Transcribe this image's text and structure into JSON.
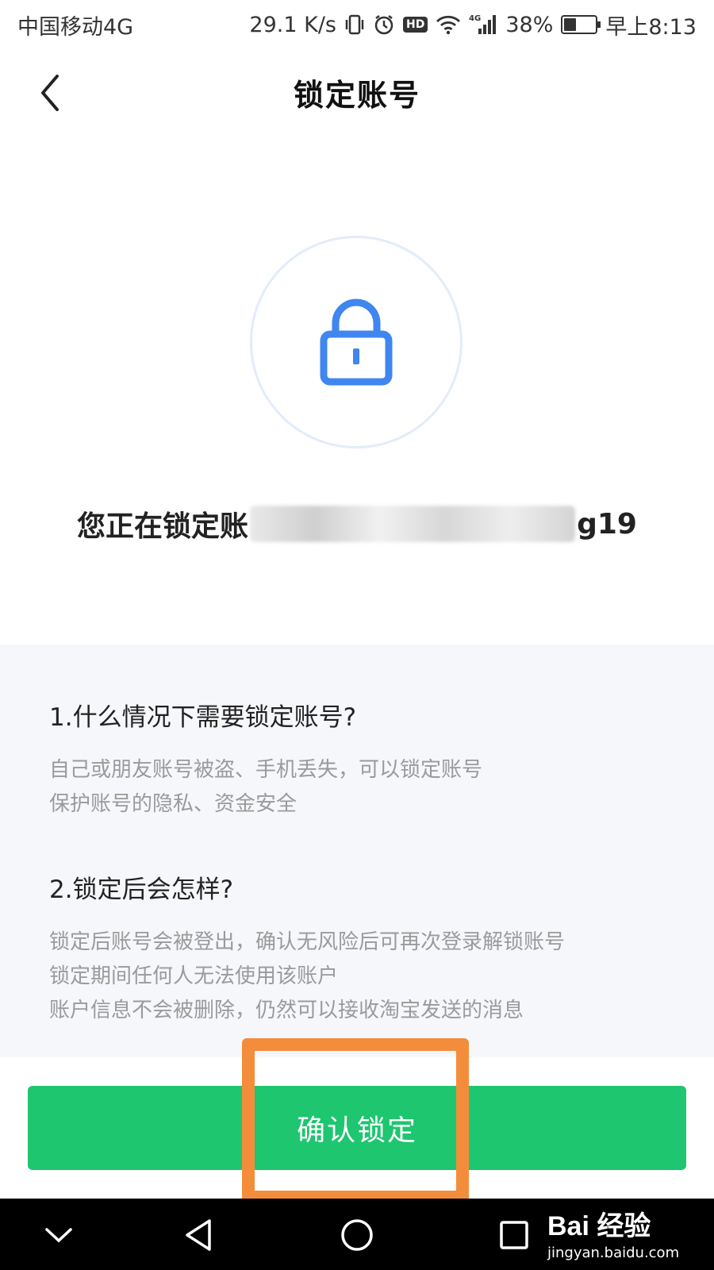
{
  "status_bar": {
    "carrier": "中国移动4G",
    "speed": "29.1 K/s",
    "hd": "HD",
    "network": "4G",
    "battery": "38%",
    "battery_level": 0.38,
    "time": "早上8:13"
  },
  "header": {
    "title": "锁定账号"
  },
  "lock": {
    "icon": "lock-icon",
    "accent": "#3f86f0"
  },
  "locking": {
    "prefix": "您正在锁定账",
    "suffix": "g19"
  },
  "info": {
    "q1": {
      "title": "1.什么情况下需要锁定账号?",
      "lines": [
        "自己或朋友账号被盗、手机丢失，可以锁定账号",
        "保护账号的隐私、资金安全"
      ]
    },
    "q2": {
      "title": "2.锁定后会怎样?",
      "lines": [
        "锁定后账号会被登出，确认无风险后可再次登录解锁账号",
        "锁定期间任何人无法使用该账户",
        "账户信息不会被删除，仍然可以接收淘宝发送的消息"
      ]
    }
  },
  "confirm": {
    "label": "确认锁定",
    "color": "#1dc66f"
  },
  "highlight_color": "#f38d3c",
  "watermark": {
    "logo": "Bai 经验",
    "url": "jingyan.baidu.com"
  }
}
